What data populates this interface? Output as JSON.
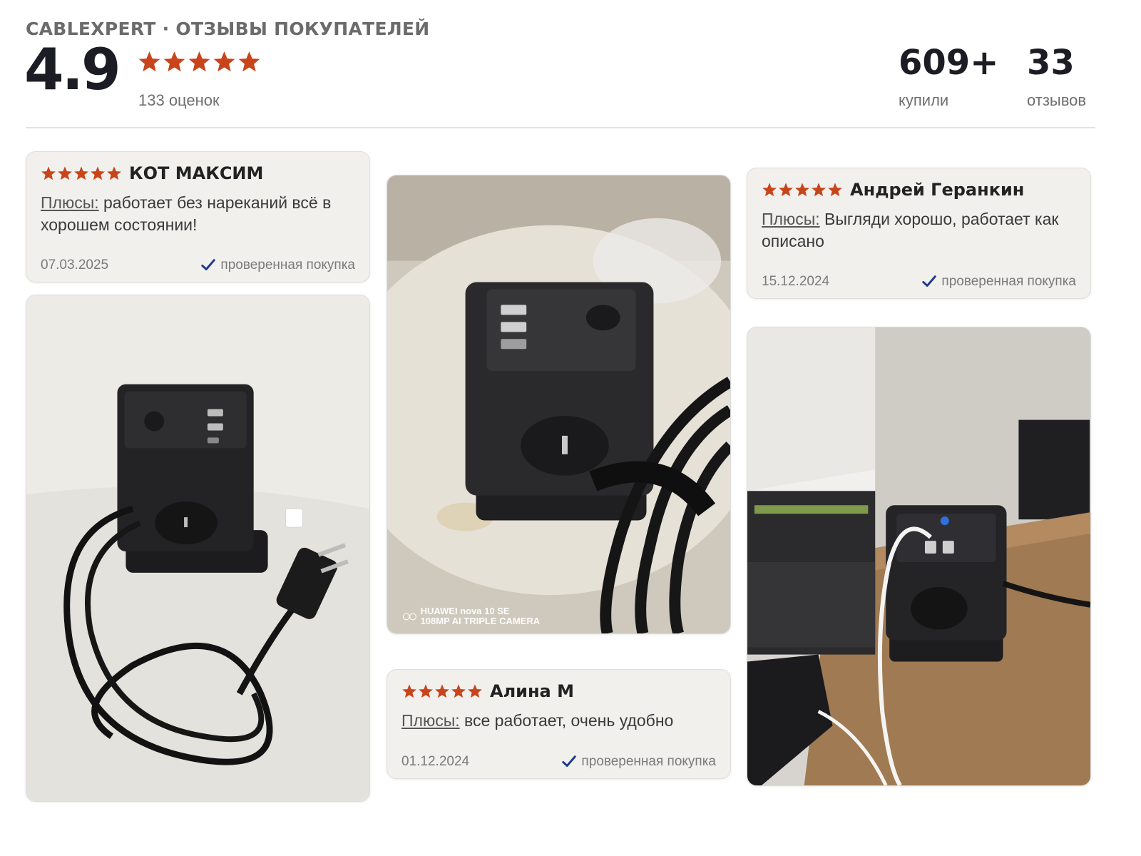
{
  "header": {
    "brand_line": "CABLEXPERT · ОТЗЫВЫ ПОКУПАТЕЛЕЙ",
    "rating": "4.9",
    "stars": 5,
    "ratings_count": "133 оценок",
    "bought": {
      "value": "609+",
      "label": "купили"
    },
    "reviews": {
      "value": "33",
      "label": "отзывов"
    }
  },
  "colors": {
    "star": "#c8441a",
    "check": "#1d3b8a",
    "card_bg": "#f1f0ed"
  },
  "reviews": [
    {
      "author": "КОТ МАКСИМ",
      "stars": 5,
      "pros_label": "Плюсы:",
      "text": "работает без нареканий всё в хорошем состоянии!",
      "date": "07.03.2025",
      "verified": "проверенная покупка"
    },
    {
      "author": "Андрей Геранкин",
      "stars": 5,
      "pros_label": "Плюсы:",
      "text": "Выгляди хорошо, работает как описано",
      "date": "15.12.2024",
      "verified": "проверенная покупка"
    },
    {
      "author": "Алина М",
      "stars": 5,
      "pros_label": "Плюсы:",
      "text": "все работает, очень удобно",
      "date": "01.12.2024",
      "verified": "проверенная покупка"
    }
  ],
  "photos": {
    "watermark_line1": "HUAWEI nova 10 SE",
    "watermark_line2": "108MP AI TRIPLE CAMERA"
  }
}
